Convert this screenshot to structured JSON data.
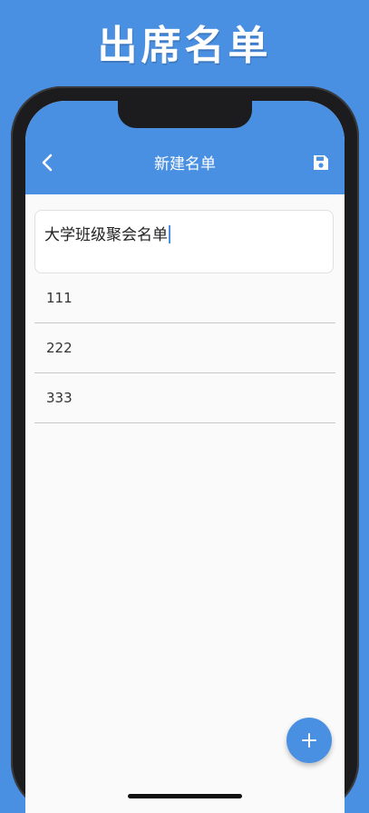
{
  "promo": {
    "title": "出席名单"
  },
  "appbar": {
    "title": "新建名单",
    "back_icon": "chevron-left-icon",
    "save_icon": "floppy-disk-icon"
  },
  "form": {
    "list_name": "大学班级聚会名单"
  },
  "list": {
    "items": [
      {
        "label": "111"
      },
      {
        "label": "222"
      },
      {
        "label": "333"
      }
    ]
  },
  "fab": {
    "icon": "plus-icon"
  },
  "colors": {
    "accent": "#4a90e2",
    "background": "#fafafa"
  }
}
